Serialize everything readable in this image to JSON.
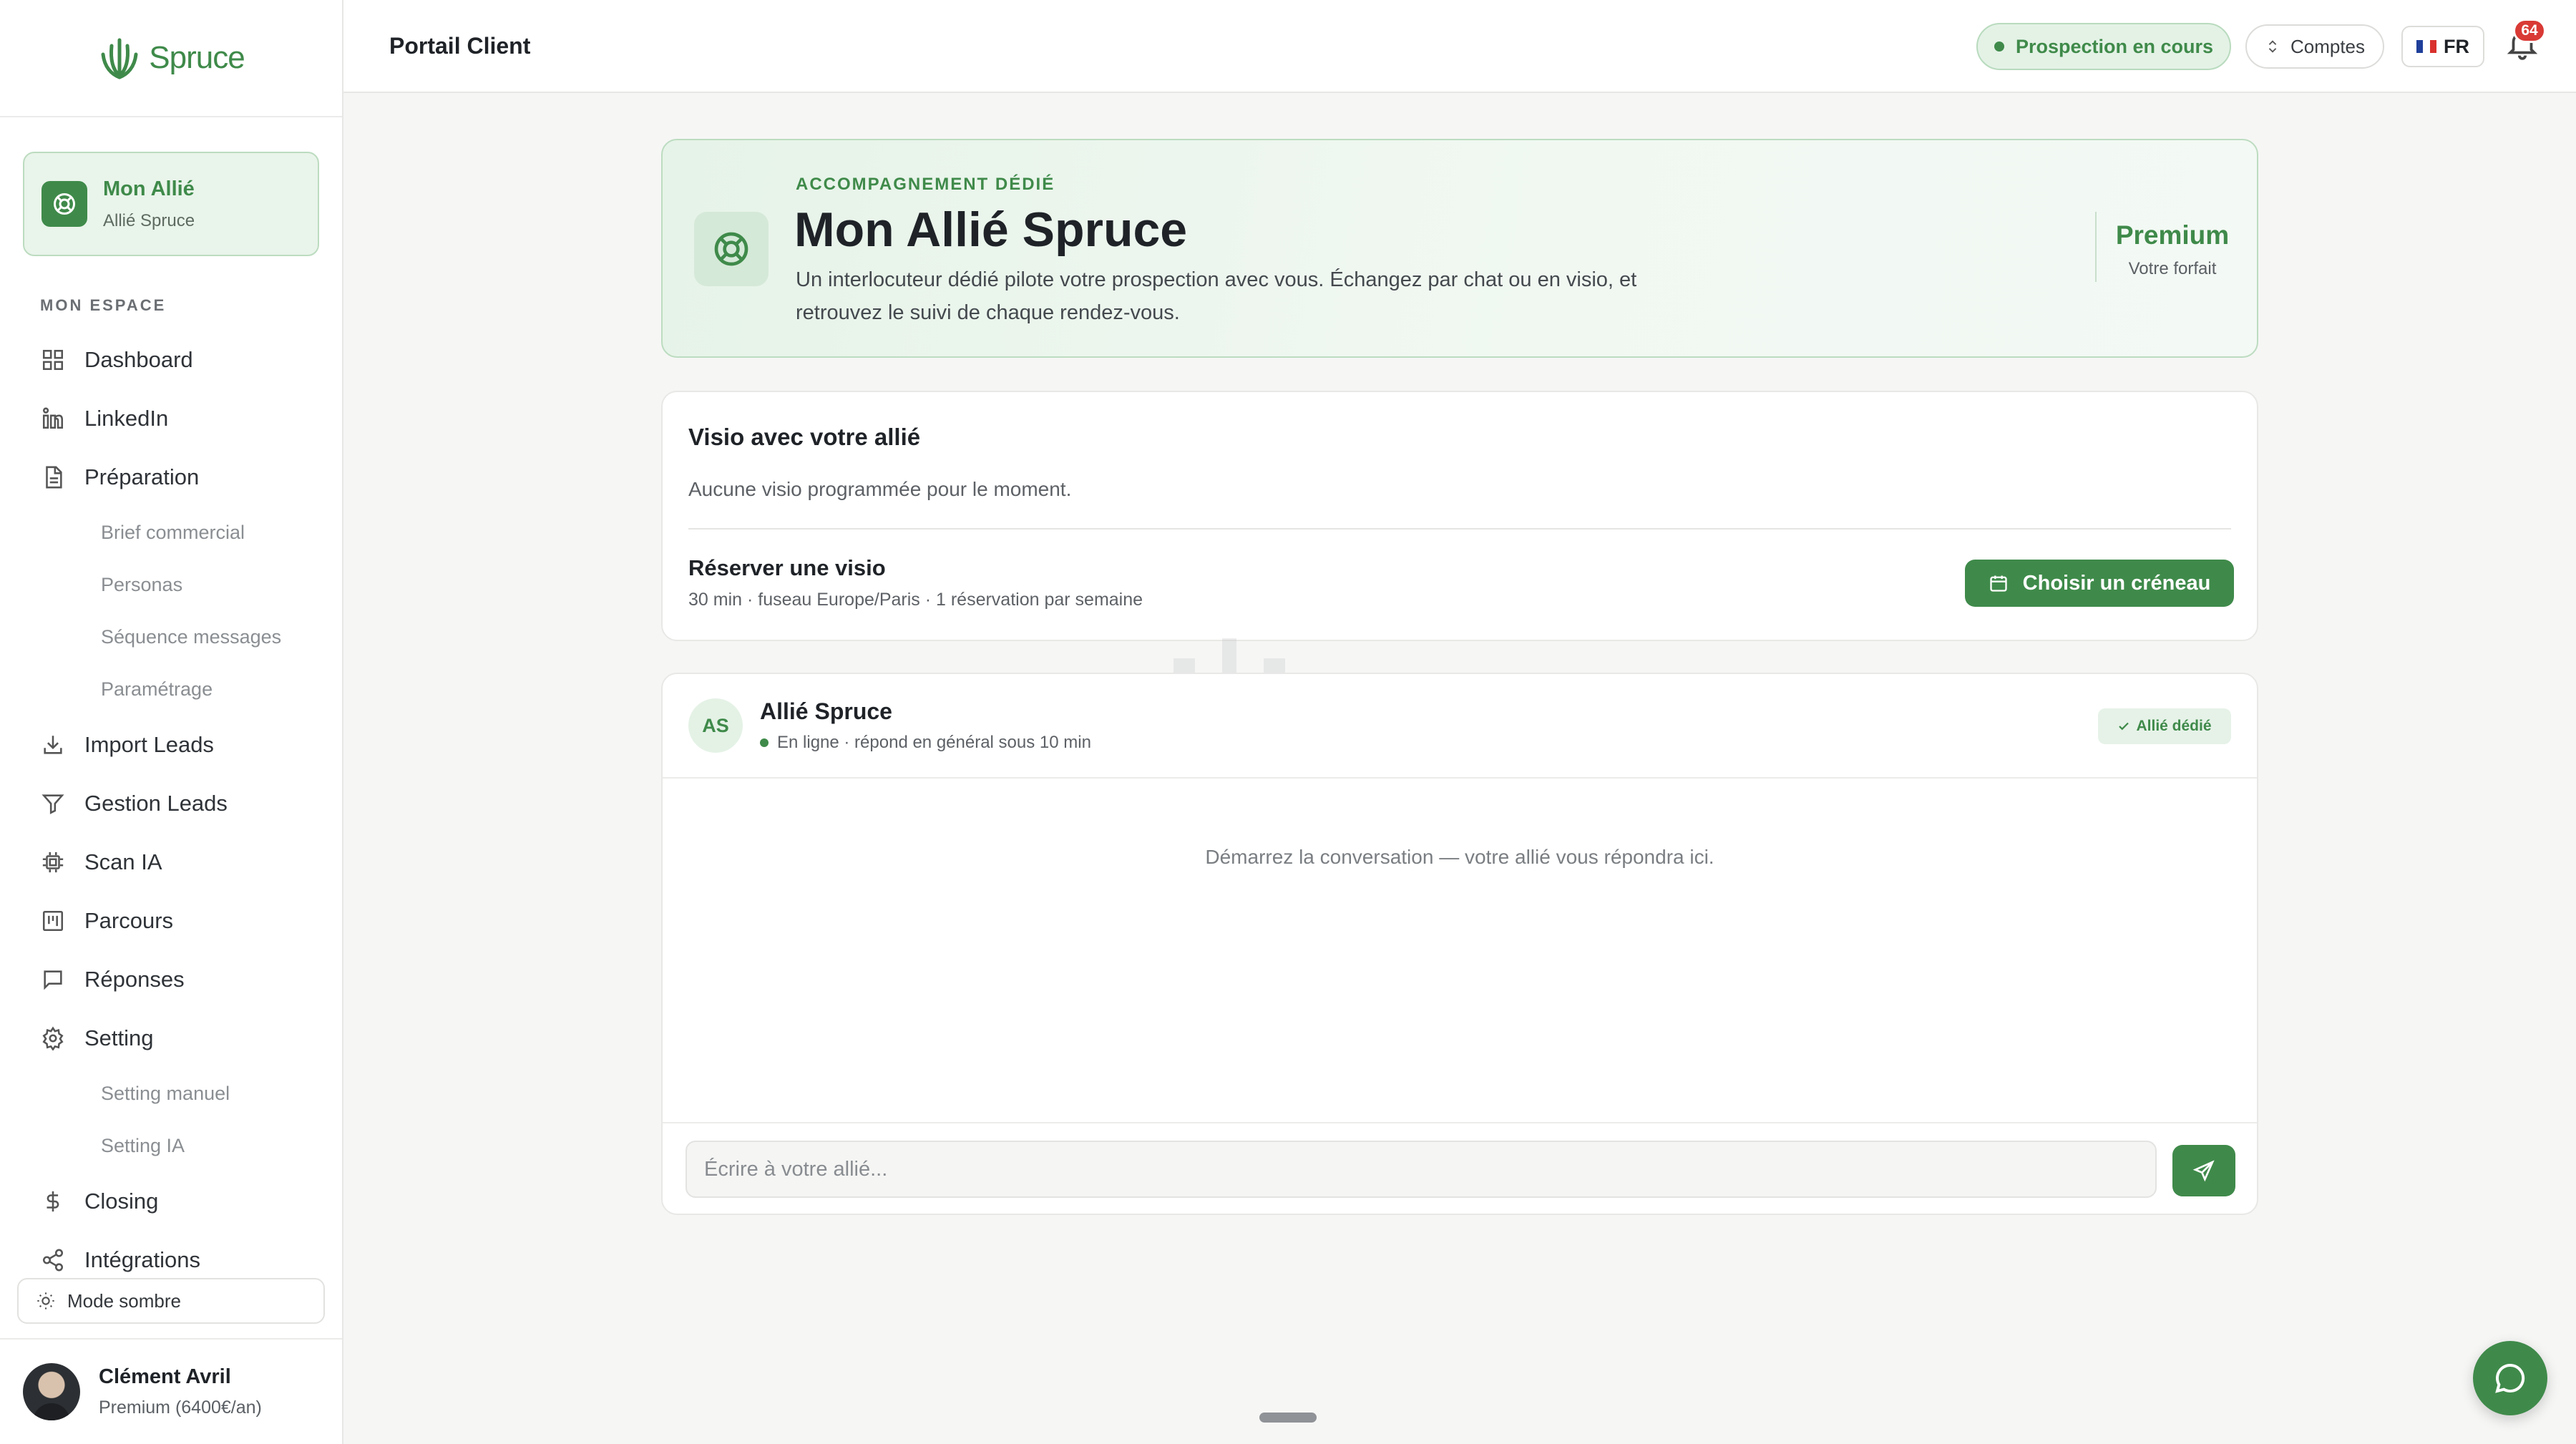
{
  "brand": {
    "name": "Spruce",
    "accent": "#3f8a4a"
  },
  "sidebar": {
    "ally_card": {
      "title": "Mon Allié",
      "subtitle": "Allié Spruce",
      "icon": "lifebuoy-icon"
    },
    "section_label": "MON ESPACE",
    "items": [
      {
        "label": "Dashboard",
        "icon": "grid-icon"
      },
      {
        "label": "LinkedIn",
        "icon": "linkedin-icon"
      },
      {
        "label": "Préparation",
        "icon": "document-icon",
        "children": [
          "Brief commercial",
          "Personas",
          "Séquence messages",
          "Paramétrage"
        ]
      },
      {
        "label": "Import Leads",
        "icon": "download-icon"
      },
      {
        "label": "Gestion Leads",
        "icon": "filter-icon"
      },
      {
        "label": "Scan IA",
        "icon": "chip-icon"
      },
      {
        "label": "Parcours",
        "icon": "kanban-icon"
      },
      {
        "label": "Réponses",
        "icon": "message-icon"
      },
      {
        "label": "Setting",
        "icon": "gear-icon",
        "children": [
          "Setting manuel",
          "Setting IA"
        ]
      },
      {
        "label": "Closing",
        "icon": "dollar-icon"
      },
      {
        "label": "Intégrations",
        "icon": "share-icon"
      }
    ],
    "dark_mode_label": "Mode sombre",
    "user": {
      "name": "Clément Avril",
      "plan": "Premium (6400€/an)"
    }
  },
  "topbar": {
    "title": "Portail Client",
    "status_label": "Prospection en cours",
    "accounts_label": "Comptes",
    "lang_label": "FR",
    "notification_count": "64"
  },
  "hero": {
    "kicker": "ACCOMPAGNEMENT DÉDIÉ",
    "title": "Mon Allié Spruce",
    "description": "Un interlocuteur dédié pilote votre prospection avec vous. Échangez par chat ou en visio, et retrouvez le suivi de chaque rendez-vous.",
    "plan": "Premium",
    "plan_label": "Votre forfait"
  },
  "visio": {
    "title": "Visio avec votre allié",
    "empty": "Aucune visio programmée pour le moment.",
    "book_title": "Réserver une visio",
    "book_meta": "30 min · fuseau Europe/Paris · 1 réservation par semaine",
    "button_label": "Choisir un créneau"
  },
  "chat": {
    "initials": "AS",
    "name": "Allié Spruce",
    "status": "En ligne · répond en général sous 10 min",
    "badge": "Allié dédié",
    "empty": "Démarrez la conversation — votre allié vous répondra ici.",
    "input_placeholder": "Écrire à votre allié..."
  }
}
